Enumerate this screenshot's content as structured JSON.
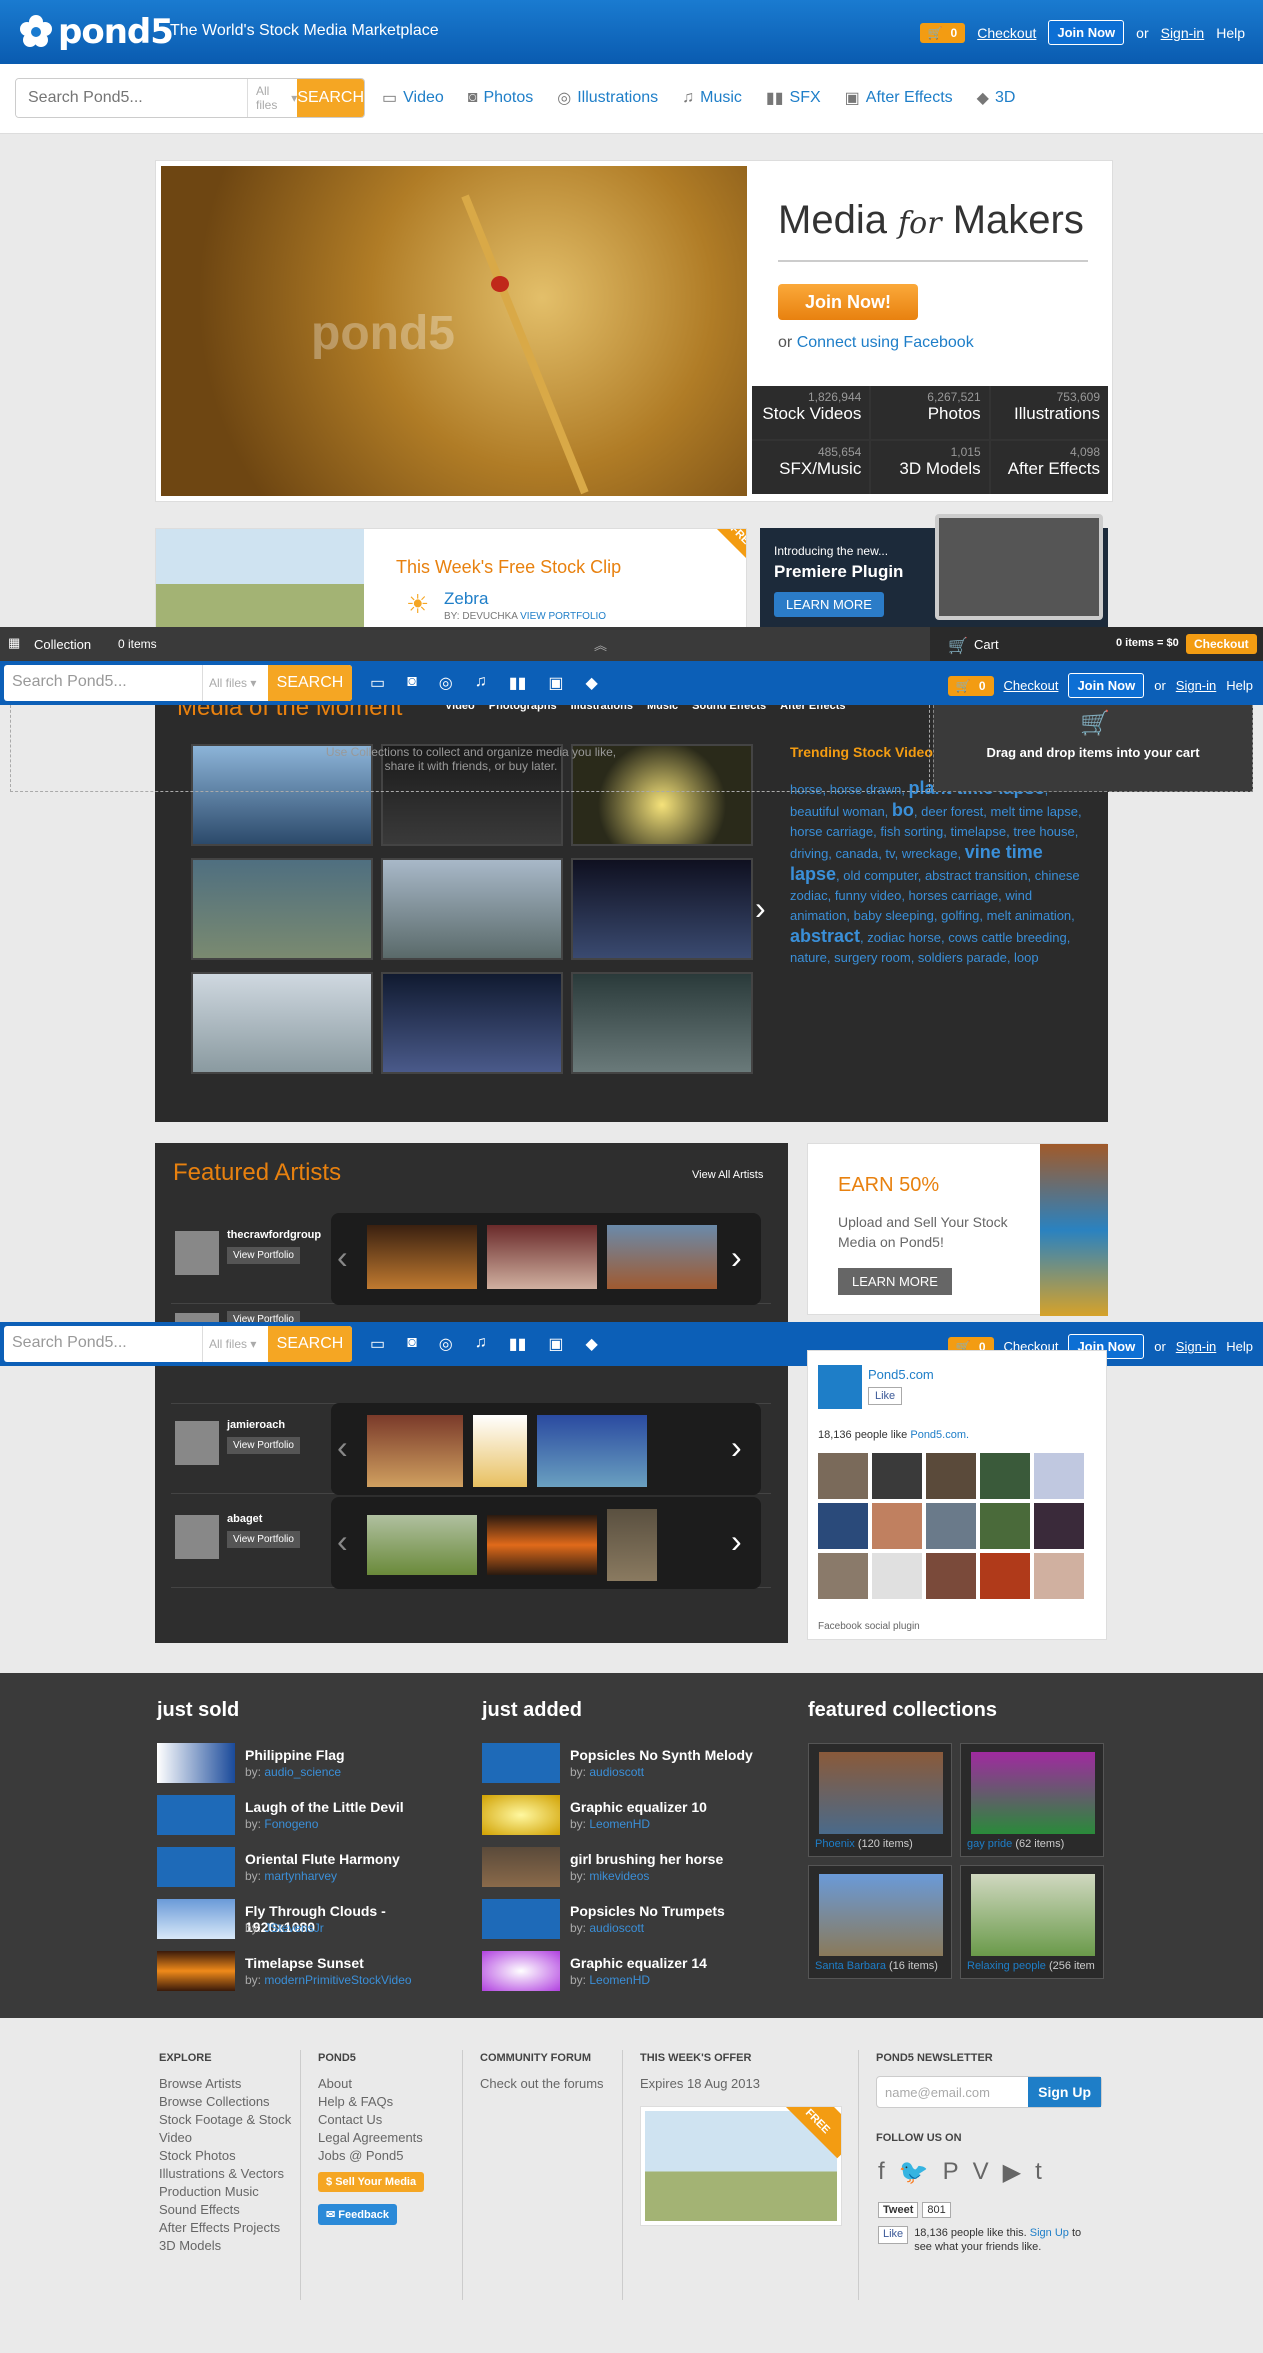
{
  "header": {
    "logo_text": "pond5",
    "tagline": "The World's Stock Media Marketplace",
    "cart_count": "0",
    "checkout": "Checkout",
    "join": "Join Now",
    "or": "or",
    "signin": "Sign-in",
    "help": "Help"
  },
  "search": {
    "placeholder": "Search Pond5...",
    "scope": "All files",
    "button": "SEARCH"
  },
  "nav": [
    "Video",
    "Photos",
    "Illustrations",
    "Music",
    "SFX",
    "After Effects",
    "3D"
  ],
  "hero": {
    "headline_media": "Media",
    "headline_for": "for",
    "headline_makers": "Makers",
    "join": "Join Now!",
    "or": "or",
    "connect": "Connect using Facebook",
    "watermark": "pond5",
    "stats": [
      {
        "n": "1,826,944",
        "l": "Stock Videos"
      },
      {
        "n": "6,267,521",
        "l": "Photos"
      },
      {
        "n": "753,609",
        "l": "Illustrations"
      },
      {
        "n": "485,654",
        "l": "SFX/Music"
      },
      {
        "n": "1,015",
        "l": "3D Models"
      },
      {
        "n": "4,098",
        "l": "After Effects"
      }
    ]
  },
  "promo": {
    "title": "This Week's Free Stock Clip",
    "clip": "Zebra",
    "by": "BY: DEVUCHKA",
    "portfolio": "VIEW PORTFOLIO",
    "free": "FREE"
  },
  "plugin": {
    "intro": "Introducing the new...",
    "title": "Premiere Plugin",
    "button": "LEARN MORE"
  },
  "collection_bar": {
    "label": "Collection",
    "count": "0 items",
    "count_suffix": "items",
    "hint": "Use Collections to collect and organize media you like, share it with friends, or buy later.",
    "cart": "Cart",
    "cart_status": "0 items = $0",
    "checkout": "Checkout",
    "drop": "Drag and drop items into your cart"
  },
  "moment": {
    "title": "Media of the Moment",
    "tabs": [
      "Video",
      "Photographs",
      "Illustrations",
      "Music",
      "Sound Effects",
      "After Effects"
    ],
    "trending_title": "Trending Stock Video",
    "tags": [
      {
        "t": "horse",
        "b": false
      },
      {
        "t": "horse drawn",
        "b": false
      },
      {
        "t": "plant time lapse",
        "b": true
      },
      {
        "t": "beautiful woman",
        "b": false
      },
      {
        "t": "bo",
        "b": true
      },
      {
        "t": "deer forest",
        "b": false
      },
      {
        "t": "melt time lapse",
        "b": false
      },
      {
        "t": "horse carriage",
        "b": false
      },
      {
        "t": "fish sorting",
        "b": false
      },
      {
        "t": "timelapse",
        "b": false
      },
      {
        "t": "tree house",
        "b": false
      },
      {
        "t": "driving",
        "b": false
      },
      {
        "t": "canada",
        "b": false
      },
      {
        "t": "tv",
        "b": false
      },
      {
        "t": "wreckage",
        "b": false
      },
      {
        "t": "vine time lapse",
        "b": true
      },
      {
        "t": "old computer",
        "b": false
      },
      {
        "t": "abstract transition",
        "b": false
      },
      {
        "t": "chinese zodiac",
        "b": false
      },
      {
        "t": "funny video",
        "b": false
      },
      {
        "t": "horses carriage",
        "b": false
      },
      {
        "t": "wind animation",
        "b": false
      },
      {
        "t": "baby sleeping",
        "b": false
      },
      {
        "t": "golfing",
        "b": false
      },
      {
        "t": "melt animation",
        "b": false
      },
      {
        "t": "abstract",
        "b": true
      },
      {
        "t": "zodiac horse",
        "b": false
      },
      {
        "t": "cows cattle breeding",
        "b": false
      },
      {
        "t": "nature",
        "b": false
      },
      {
        "t": "surgery room",
        "b": false
      },
      {
        "t": "soldiers parade",
        "b": false
      },
      {
        "t": "loop",
        "b": false
      }
    ]
  },
  "artists": {
    "title": "Featured Artists",
    "view_all": "View All Artists",
    "view_portfolio": "View Portfolio",
    "list": [
      "thecrawfordgroup",
      "",
      "jamieroach",
      "abaget"
    ]
  },
  "earn": {
    "title": "EARN 50%",
    "text": "Upload and Sell Your Stock Media on Pond5!",
    "button": "LEARN MORE"
  },
  "facebook": {
    "page": "Pond5.com",
    "like": "Like",
    "count_text": "18,136 people like",
    "count_link": "Pond5.com.",
    "plugin": "Facebook social plugin"
  },
  "just_sold": {
    "title": "just sold",
    "items": [
      {
        "title": "Philippine Flag",
        "by": "audio_science"
      },
      {
        "title": "Laugh of the Little Devil",
        "by": "Fonogeno"
      },
      {
        "title": "Oriental Flute Harmony",
        "by": "martynharvey"
      },
      {
        "title": "Fly Through Clouds - 1920x1080",
        "by": "JStevensJr"
      },
      {
        "title": "Timelapse Sunset",
        "by": "modernPrimitiveStockVideo"
      }
    ]
  },
  "just_added": {
    "title": "just added",
    "items": [
      {
        "title": "Popsicles No Synth Melody",
        "by": "audioscott"
      },
      {
        "title": "Graphic equalizer 10",
        "by": "LeomenHD"
      },
      {
        "title": "girl brushing her horse",
        "by": "mikevideos"
      },
      {
        "title": "Popsicles No Trumpets",
        "by": "audioscott"
      },
      {
        "title": "Graphic equalizer 14",
        "by": "LeomenHD"
      }
    ]
  },
  "featured_collections": {
    "title": "featured collections",
    "items": [
      {
        "name": "Phoenix",
        "count": "(120 items)"
      },
      {
        "name": "gay pride",
        "count": "(62 items)"
      },
      {
        "name": "Santa Barbara",
        "count": "(16 items)"
      },
      {
        "name": "Relaxing people",
        "count": "(256 item"
      }
    ]
  },
  "by_label": "by:",
  "footer": {
    "explore_title": "EXPLORE",
    "explore": [
      "Browse Artists",
      "Browse Collections",
      "Stock Footage & Stock",
      "Video",
      "Stock Photos",
      "Illustrations & Vectors",
      "Production Music",
      "Sound Effects",
      "After Effects Projects",
      "3D Models"
    ],
    "pond5_title": "POND5",
    "pond5": [
      "About",
      "Help & FAQs",
      "Contact Us",
      "Legal Agreements",
      "Jobs @ Pond5"
    ],
    "sell": "Sell Your Media",
    "feedback": "Feedback",
    "forum_title": "COMMUNITY FORUM",
    "forum_link": "Check out the forums",
    "offer_title": "THIS WEEK'S OFFER",
    "offer_expires": "Expires 18 Aug 2013",
    "offer_free": "FREE",
    "newsletter_title": "POND5 NEWSLETTER",
    "newsletter_placeholder": "name@email.com",
    "signup": "Sign Up",
    "follow": "FOLLOW US ON",
    "tweet": "Tweet",
    "tweet_count": "801",
    "fb_like": "Like",
    "fb_text_a": "18,136 people like this.",
    "fb_signup": "Sign Up",
    "fb_text_b": "to see what your friends like."
  },
  "colors": {
    "brand_blue": "#0a5bb0",
    "accent_orange": "#f39c12",
    "link_blue": "#1e7ec8"
  }
}
